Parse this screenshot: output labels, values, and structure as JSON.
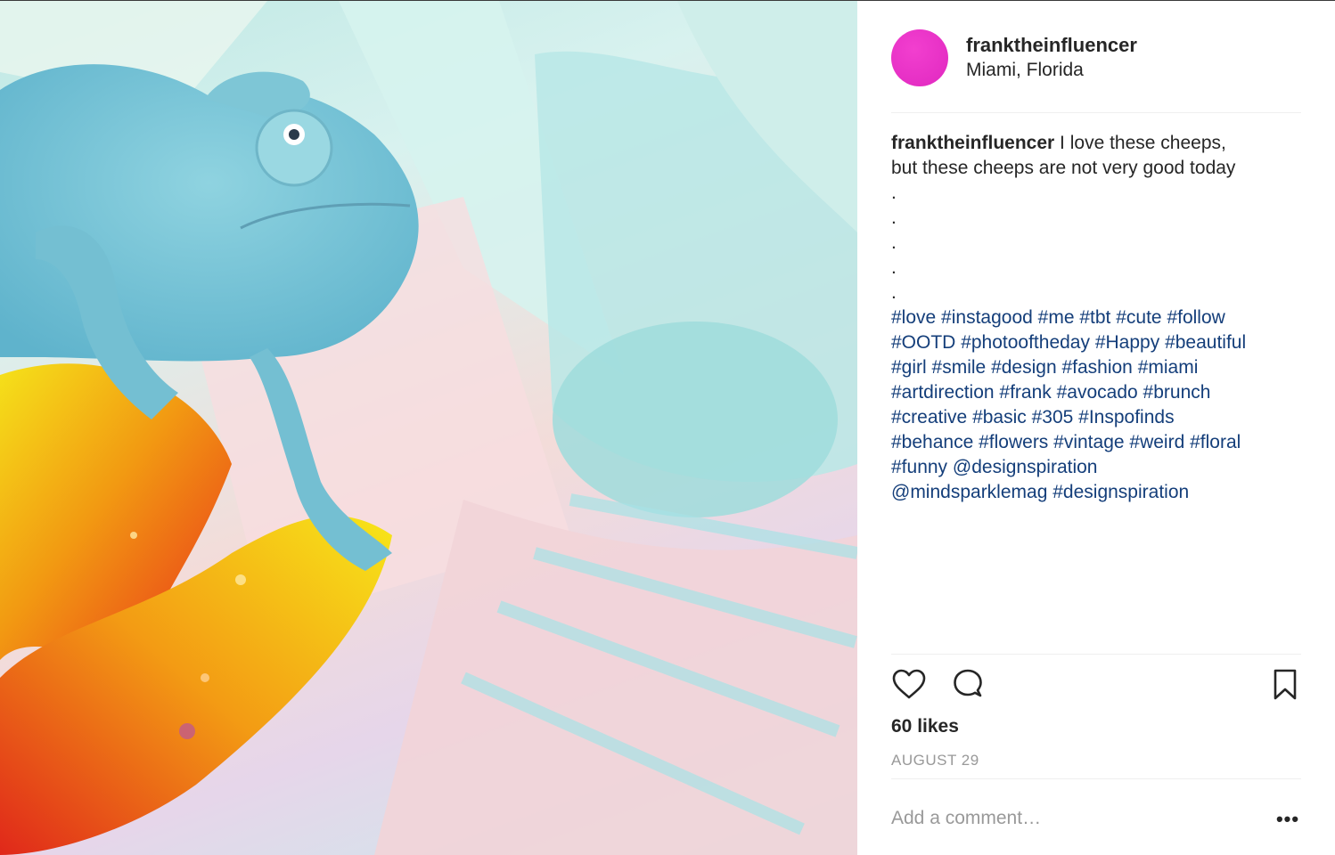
{
  "post": {
    "username": "franktheinfluencer",
    "location": "Miami, Florida",
    "caption": {
      "username": "franktheinfluencer",
      "text_line1": " I love these cheeps,",
      "text_line2": "but these cheeps are not very good today",
      "dots": [
        ".",
        ".",
        ".",
        ".",
        "."
      ],
      "tag_lines": [
        [
          "#love",
          "#instagood",
          "#me",
          "#tbt",
          "#cute",
          "#follow"
        ],
        [
          "#OOTD",
          "#photooftheday",
          "#Happy",
          "#beautiful"
        ],
        [
          "#girl",
          "#smile",
          "#design",
          "#fashion",
          "#miami"
        ],
        [
          "#artdirection",
          "#frank",
          "#avocado",
          "#brunch"
        ],
        [
          "#creative",
          "#basic",
          "#305",
          "#Inspofinds"
        ],
        [
          "#behance",
          "#flowers",
          "#vintage",
          "#weird",
          "#floral"
        ],
        [
          "#funny",
          "@designspiration"
        ],
        [
          "@mindsparklemag",
          "#designspiration"
        ]
      ]
    },
    "likes": "60 likes",
    "date": "AUGUST 29",
    "comment_placeholder": "Add a comment…",
    "more_label": "•••"
  },
  "icons": {
    "like": "heart-icon",
    "comment": "comment-icon",
    "save": "bookmark-icon",
    "more": "more-options-icon"
  },
  "colors": {
    "avatar": "#e52bc4",
    "hashtag": "#143e7a",
    "text": "#262626",
    "muted": "#999999"
  }
}
